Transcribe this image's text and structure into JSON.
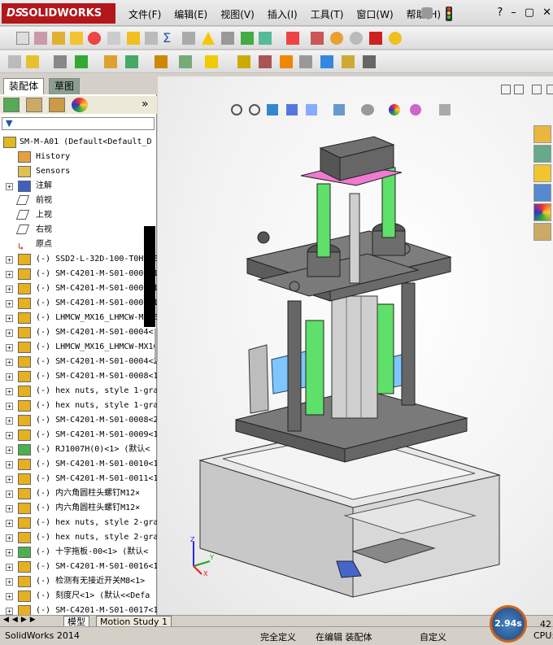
{
  "app": {
    "logo_prefix": "DS",
    "logo_text": "SOLIDWORKS"
  },
  "menu": [
    "文件(F)",
    "编辑(E)",
    "视图(V)",
    "插入(I)",
    "工具(T)",
    "窗口(W)",
    "帮助(H)"
  ],
  "window_buttons": {
    "help": "?",
    "minimize": "–",
    "restore": "▢",
    "close": "✕"
  },
  "panel_tabs": {
    "assembly": "装配体",
    "sketch": "草图"
  },
  "panel_more": "»",
  "tree": [
    {
      "label": "SM-M-A01  (Default<Default_D",
      "icon": "assembly-icon",
      "indent": 0,
      "expand": false
    },
    {
      "label": "History",
      "icon": "history-icon",
      "indent": 1,
      "expand": false
    },
    {
      "label": "Sensors",
      "icon": "sensor-icon",
      "indent": 1,
      "expand": false
    },
    {
      "label": "注解",
      "icon": "annotation-icon",
      "indent": 1,
      "expand": true
    },
    {
      "label": "前视",
      "icon": "plane-icon",
      "indent": 1,
      "expand": false
    },
    {
      "label": "上视",
      "icon": "plane-icon",
      "indent": 1,
      "expand": false
    },
    {
      "label": "右视",
      "icon": "plane-icon",
      "indent": 1,
      "expand": false
    },
    {
      "label": "原点",
      "icon": "origin-icon",
      "indent": 1,
      "expand": false
    },
    {
      "label": "(-) SSD2-L-32D-100-T0H3-E",
      "icon": "part-icon",
      "indent": 1,
      "expand": true
    },
    {
      "label": "(-) SM-C4201-M-S01-0002<1",
      "icon": "part-icon",
      "indent": 1,
      "expand": true
    },
    {
      "label": "(-) SM-C4201-M-S01-0006<1",
      "icon": "part-icon",
      "indent": 1,
      "expand": true
    },
    {
      "label": "(-) SM-C4201-M-S01-0003<1",
      "icon": "part-icon",
      "indent": 1,
      "expand": true
    },
    {
      "label": "(-) LHMCW_MX16_LHMCW-MX16",
      "icon": "part-icon",
      "indent": 1,
      "expand": true
    },
    {
      "label": "(-) SM-C4201-M-S01-0004<1",
      "icon": "part-icon",
      "indent": 1,
      "expand": true
    },
    {
      "label": "(-) LHMCW_MX16_LHMCW-MX16",
      "icon": "part-icon",
      "indent": 1,
      "expand": true
    },
    {
      "label": "(-) SM-C4201-M-S01-0004<2",
      "icon": "part-icon",
      "indent": 1,
      "expand": true
    },
    {
      "label": "(-) SM-C4201-M-S01-0008<1",
      "icon": "part-icon",
      "indent": 1,
      "expand": true
    },
    {
      "label": "(-) hex nuts, style 1-gra",
      "icon": "part-icon",
      "indent": 1,
      "expand": true
    },
    {
      "label": "(-) hex nuts, style 1-gra",
      "icon": "part-icon",
      "indent": 1,
      "expand": true
    },
    {
      "label": "(-) SM-C4201-M-S01-0008<2",
      "icon": "part-icon",
      "indent": 1,
      "expand": true
    },
    {
      "label": "(-) SM-C4201-M-S01-0009<1",
      "icon": "part-icon",
      "indent": 1,
      "expand": true
    },
    {
      "label": "(-) RJ1007H(0)<1> (默认<",
      "icon": "subasm-icon",
      "indent": 1,
      "expand": true
    },
    {
      "label": "(-) SM-C4201-M-S01-0010<1",
      "icon": "part-icon",
      "indent": 1,
      "expand": true
    },
    {
      "label": "(-) SM-C4201-M-S01-0011<1",
      "icon": "part-icon",
      "indent": 1,
      "expand": true
    },
    {
      "label": "(-) 内六角圆柱头螺钉M12×",
      "icon": "part-icon",
      "indent": 1,
      "expand": true
    },
    {
      "label": "(-) 内六角圆柱头螺钉M12×",
      "icon": "part-icon",
      "indent": 1,
      "expand": true
    },
    {
      "label": "(-) hex nuts, style 2-gra",
      "icon": "part-icon",
      "indent": 1,
      "expand": true
    },
    {
      "label": "(-) hex nuts, style 2-gra",
      "icon": "part-icon",
      "indent": 1,
      "expand": true
    },
    {
      "label": "(-) 十字拖板-00<1> (默认<",
      "icon": "subasm-icon",
      "indent": 1,
      "expand": true
    },
    {
      "label": "(-) SM-C4201-M-S01-0016<1",
      "icon": "part-icon",
      "indent": 1,
      "expand": true
    },
    {
      "label": "(-) 检测有无接近开关M8<1>",
      "icon": "part-icon",
      "indent": 1,
      "expand": true
    },
    {
      "label": "(-) 刻度尺<1> (默认<<Defa",
      "icon": "part-icon",
      "indent": 1,
      "expand": true
    },
    {
      "label": "(-) SM-C4201-M-S01-0017<1",
      "icon": "part-icon",
      "indent": 1,
      "expand": true
    }
  ],
  "bottom_tabs": {
    "model": "模型",
    "motion": "Motion Study 1"
  },
  "status": {
    "app": "SolidWorks 2014",
    "constraint": "完全定义",
    "editing": "在编辑 装配体",
    "units": "自定义",
    "gauge": "2.94s",
    "cpu_label": "CPU:",
    "cpu_value": "42"
  },
  "triad": {
    "x": "X",
    "y": "Y",
    "z": "Z"
  },
  "colors": {
    "logo_red": "#b3161b",
    "part_yellow": "#f0c020",
    "model_gray": "#6e6e6e",
    "accent_green": "#5ee06a",
    "accent_pink": "#f07ad0",
    "accent_blue": "#7fc6ff"
  }
}
